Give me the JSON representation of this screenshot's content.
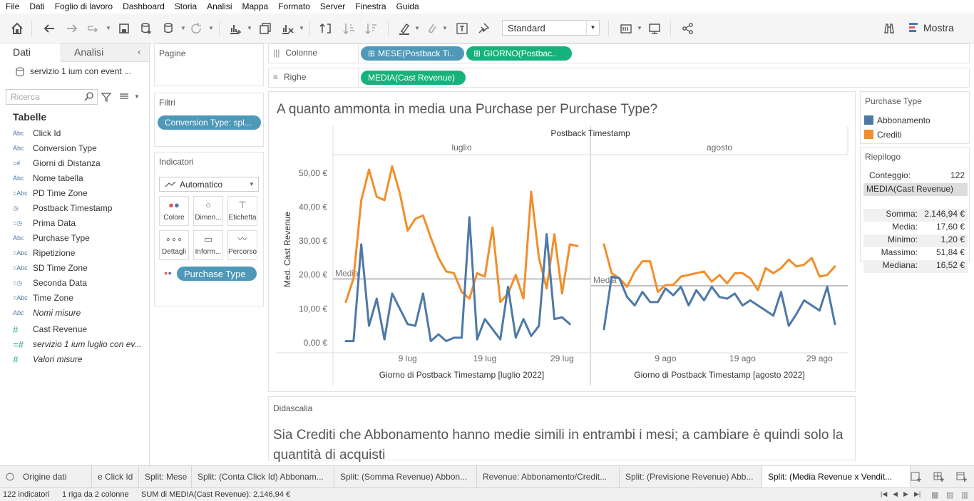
{
  "menu": [
    "File",
    "Dati",
    "Foglio di lavoro",
    "Dashboard",
    "Storia",
    "Analisi",
    "Mappa",
    "Formato",
    "Server",
    "Finestra",
    "Guida"
  ],
  "toolbar": {
    "standard_label": "Standard",
    "mostra_label": "Mostra"
  },
  "left_pane": {
    "tab_dati": "Dati",
    "tab_analisi": "Analisi",
    "data_source": "servizio 1 ium con event ...",
    "search_placeholder": "Ricerca",
    "tables_heading": "Tabelle",
    "fields": [
      {
        "icon": "Abc",
        "label": "Click Id"
      },
      {
        "icon": "Abc",
        "label": "Conversion Type"
      },
      {
        "icon": "=#",
        "label": "Giorni di Distanza"
      },
      {
        "icon": "Abc",
        "label": "Nome tabella"
      },
      {
        "icon": "=Abc",
        "label": "PD Time Zone"
      },
      {
        "icon": "date",
        "label": "Postback Timestamp"
      },
      {
        "icon": "=date",
        "label": "Prima Data"
      },
      {
        "icon": "Abc",
        "label": "Purchase Type"
      },
      {
        "icon": "=Abc",
        "label": "Ripetizione"
      },
      {
        "icon": "=Abc",
        "label": "SD Time Zone"
      },
      {
        "icon": "=date",
        "label": "Seconda Data"
      },
      {
        "icon": "=Abc",
        "label": "Time Zone"
      },
      {
        "icon": "Abc",
        "label": "Nomi misure"
      }
    ],
    "measures": [
      {
        "icon": "#",
        "label": "Cast Revenue"
      },
      {
        "icon": "=#",
        "label": "servizio 1 ium luglio con ev..."
      },
      {
        "icon": "#",
        "label": "Valori misure"
      }
    ]
  },
  "cards": {
    "pagine": "Pagine",
    "filtri": "Filtri",
    "filter_pill": "Conversion Type: spl...",
    "indicatori": "Indicatori",
    "mark_type": "Automatico",
    "marks": [
      "Colore",
      "Dimen...",
      "Etichetta",
      "Dettagli",
      "Inform...",
      "Percorso"
    ],
    "color_pill": "Purchase Type"
  },
  "shelves": {
    "colonne_label": "Colonne",
    "righe_label": "Righe",
    "col_pills": [
      "MESE(Postback Ti..",
      "GIORNO(Postbac.."
    ],
    "row_pills": [
      "MEDIA(Cast Revenue)"
    ]
  },
  "viz": {
    "title": "A quanto ammonta in media una Purchase per Purchase Type?",
    "header_top": "Postback Timestamp",
    "avg_label": "Media"
  },
  "caption": {
    "title": "Didascalia",
    "text": "Sia Crediti che Abbonamento hanno medie simili in entrambi i mesi; a cambiare è quindi solo la quantità di acquisti"
  },
  "legend": {
    "title": "Purchase Type",
    "items": [
      {
        "label": "Abbonamento",
        "color": "#4e79a7"
      },
      {
        "label": "Crediti",
        "color": "#f28e2b"
      }
    ]
  },
  "summary": {
    "title": "Riepilogo",
    "count_label": "Conteggio:",
    "count_value": "122",
    "measure_header": "MEDIA(Cast Revenue)",
    "rows": [
      {
        "k": "Somma:",
        "v": "2.146,94 €"
      },
      {
        "k": "Media:",
        "v": "17,60 €"
      },
      {
        "k": "Minimo:",
        "v": "1,20 €"
      },
      {
        "k": "Massimo:",
        "v": "51,84 €"
      },
      {
        "k": "Mediana:",
        "v": "16,52 €"
      }
    ]
  },
  "sheet_tabs": [
    {
      "label": "Origine dati",
      "sel": false
    },
    {
      "label": "e Click Id",
      "sel": false
    },
    {
      "label": "Split: Mese",
      "sel": false
    },
    {
      "label": "Split: (Conta Click Id) Abbonam...",
      "sel": false
    },
    {
      "label": "Split: (Somma Revenue) Abbon...",
      "sel": false
    },
    {
      "label": "Revenue: Abbonamento/Credit...",
      "sel": false
    },
    {
      "label": "Split: (Previsione Revenue) Abb...",
      "sel": false
    },
    {
      "label": "Split: (Media Revenue x Vendit...",
      "sel": true
    }
  ],
  "status": {
    "marks": "122 indicatori",
    "rows": "1 riga da 2 colonne",
    "sum": "SUM di MEDIA(Cast Revenue): 2.146,94 €"
  },
  "chart_data": {
    "type": "line",
    "title": "A quanto ammonta in media una Purchase per Purchase Type?",
    "ylabel": "Med. Cast Revenue",
    "ylim": [
      0,
      55
    ],
    "yticks": [
      "0,00 €",
      "10,00 €",
      "20,00 €",
      "30,00 €",
      "40,00 €",
      "50,00 €"
    ],
    "ytick_values": [
      0,
      10,
      20,
      30,
      40,
      50
    ],
    "grid": false,
    "legend_position": "right",
    "panels": [
      {
        "month": "luglio",
        "xlabel": "Giorno di Postback Timestamp [luglio 2022]",
        "xticks": [
          "9 lug",
          "19 lug",
          "29 lug"
        ],
        "xtick_days": [
          9,
          19,
          29
        ],
        "average": 18.8,
        "series": [
          {
            "name": "Abbonamento",
            "color": "#4e79a7",
            "x": [
              1,
              2,
              3,
              4,
              5,
              6,
              7,
              8,
              9,
              10,
              11,
              12,
              13,
              14,
              15,
              16,
              17,
              18,
              19,
              20,
              21,
              22,
              23,
              24,
              25,
              26,
              27,
              28,
              29,
              30
            ],
            "values": [
              0.5,
              0.5,
              29,
              5,
              13,
              1,
              14.5,
              10,
              5.5,
              5,
              14.5,
              0.5,
              2.5,
              0.5,
              1.5,
              1.5,
              37,
              1,
              7,
              4,
              1,
              16.5,
              1.5,
              7,
              2,
              5,
              32,
              7,
              7.5,
              5.5
            ]
          },
          {
            "name": "Crediti",
            "color": "#f28e2b",
            "x": [
              1,
              2,
              3,
              4,
              5,
              6,
              7,
              8,
              9,
              10,
              11,
              12,
              13,
              14,
              15,
              16,
              17,
              18,
              19,
              20,
              21,
              22,
              23,
              24,
              25,
              26,
              27,
              28,
              29,
              30,
              31
            ],
            "values": [
              12,
              19,
              42,
              51,
              43,
              42,
              52,
              44,
              33,
              36.5,
              37.5,
              31,
              25,
              21,
              20.5,
              15,
              13,
              20.5,
              19.5,
              34,
              12,
              14.5,
              20,
              13,
              44.5,
              25,
              16,
              32,
              14.5,
              29,
              28.5
            ]
          }
        ]
      },
      {
        "month": "agosto",
        "xlabel": "Giorno di Postback Timestamp [agosto 2022]",
        "xticks": [
          "9 ago",
          "19 ago",
          "29 ago"
        ],
        "xtick_days": [
          9,
          19,
          29
        ],
        "average": 16.8,
        "series": [
          {
            "name": "Abbonamento",
            "color": "#4e79a7",
            "x": [
              1,
              2,
              3,
              4,
              5,
              6,
              7,
              8,
              9,
              10,
              11,
              12,
              13,
              14,
              15,
              16,
              17,
              18,
              19,
              20,
              21,
              22,
              23,
              24,
              25,
              26,
              27,
              28,
              29,
              30,
              31
            ],
            "values": [
              4,
              19.5,
              19,
              13.5,
              11,
              15,
              12,
              12,
              16,
              14,
              16.5,
              11,
              15.5,
              12.5,
              16.5,
              13.5,
              13,
              14.5,
              11,
              12.5,
              11,
              9.5,
              8,
              15,
              5,
              8.5,
              12.5,
              11,
              9.5,
              16.5,
              5.5
            ]
          },
          {
            "name": "Crediti",
            "color": "#f28e2b",
            "x": [
              1,
              2,
              3,
              4,
              5,
              6,
              7,
              8,
              9,
              10,
              11,
              12,
              13,
              14,
              15,
              16,
              17,
              18,
              19,
              20,
              21,
              22,
              23,
              24,
              25,
              26,
              27,
              28,
              29,
              30,
              31
            ],
            "values": [
              29,
              20.5,
              19,
              16.5,
              21,
              24,
              24,
              15,
              17,
              17,
              19.5,
              20,
              20.5,
              21,
              18,
              20,
              17.5,
              20.5,
              20.5,
              19,
              15.5,
              22,
              20.5,
              22,
              24.5,
              22.5,
              23,
              25,
              19.5,
              20,
              22.5
            ]
          }
        ]
      }
    ]
  }
}
